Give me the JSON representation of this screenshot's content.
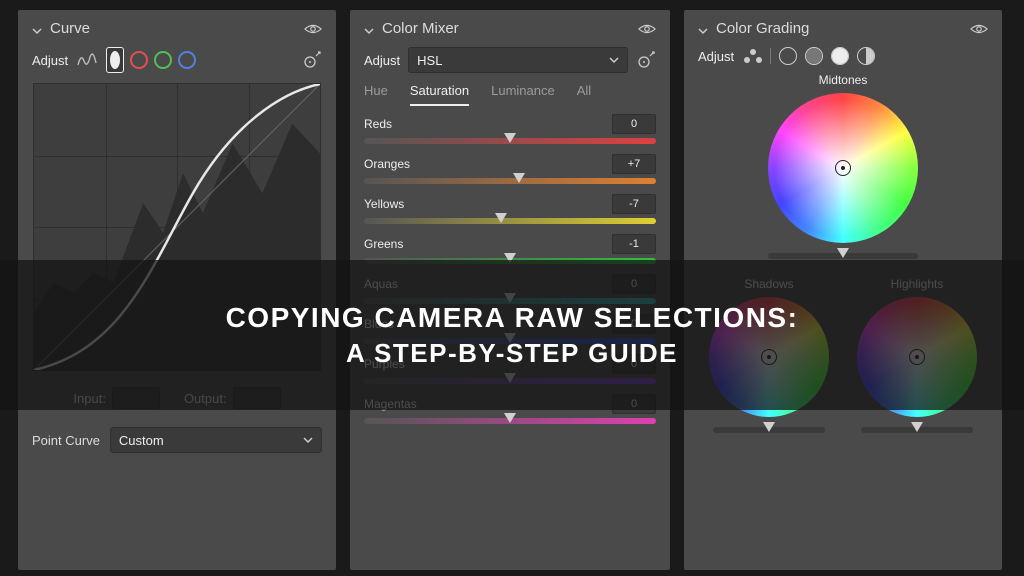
{
  "panels": {
    "curve": {
      "title": "Curve",
      "adjust_label": "Adjust",
      "input_label": "Input:",
      "output_label": "Output:",
      "point_curve_label": "Point Curve",
      "point_curve_value": "Custom"
    },
    "mixer": {
      "title": "Color Mixer",
      "adjust_label": "Adjust",
      "mode": "HSL",
      "tabs": {
        "hue": "Hue",
        "sat": "Saturation",
        "lum": "Luminance",
        "all": "All"
      },
      "rows": [
        {
          "name": "Reds",
          "value": "0",
          "pos": 50,
          "grad": "linear-gradient(90deg,#555,#e04040)"
        },
        {
          "name": "Oranges",
          "value": "+7",
          "pos": 53,
          "grad": "linear-gradient(90deg,#555,#e08030)"
        },
        {
          "name": "Yellows",
          "value": "-7",
          "pos": 47,
          "grad": "linear-gradient(90deg,#555,#e0d030)"
        },
        {
          "name": "Greens",
          "value": "-1",
          "pos": 50,
          "grad": "linear-gradient(90deg,#555,#30c040)"
        },
        {
          "name": "Aquas",
          "value": "0",
          "pos": 50,
          "grad": "linear-gradient(90deg,#555,#30c0c0)"
        },
        {
          "name": "Blues",
          "value": "0",
          "pos": 50,
          "grad": "linear-gradient(90deg,#555,#3050e0)"
        },
        {
          "name": "Purples",
          "value": "0",
          "pos": 50,
          "grad": "linear-gradient(90deg,#555,#8040e0)"
        },
        {
          "name": "Magentas",
          "value": "0",
          "pos": 50,
          "grad": "linear-gradient(90deg,#555,#e040b0)"
        }
      ]
    },
    "grading": {
      "title": "Color Grading",
      "adjust_label": "Adjust",
      "midtones": "Midtones",
      "shadows": "Shadows",
      "highlights": "Highlights"
    }
  },
  "overlay": {
    "line1": "COPYING CAMERA RAW SELECTIONS:",
    "line2": "A STEP-BY-STEP GUIDE"
  }
}
